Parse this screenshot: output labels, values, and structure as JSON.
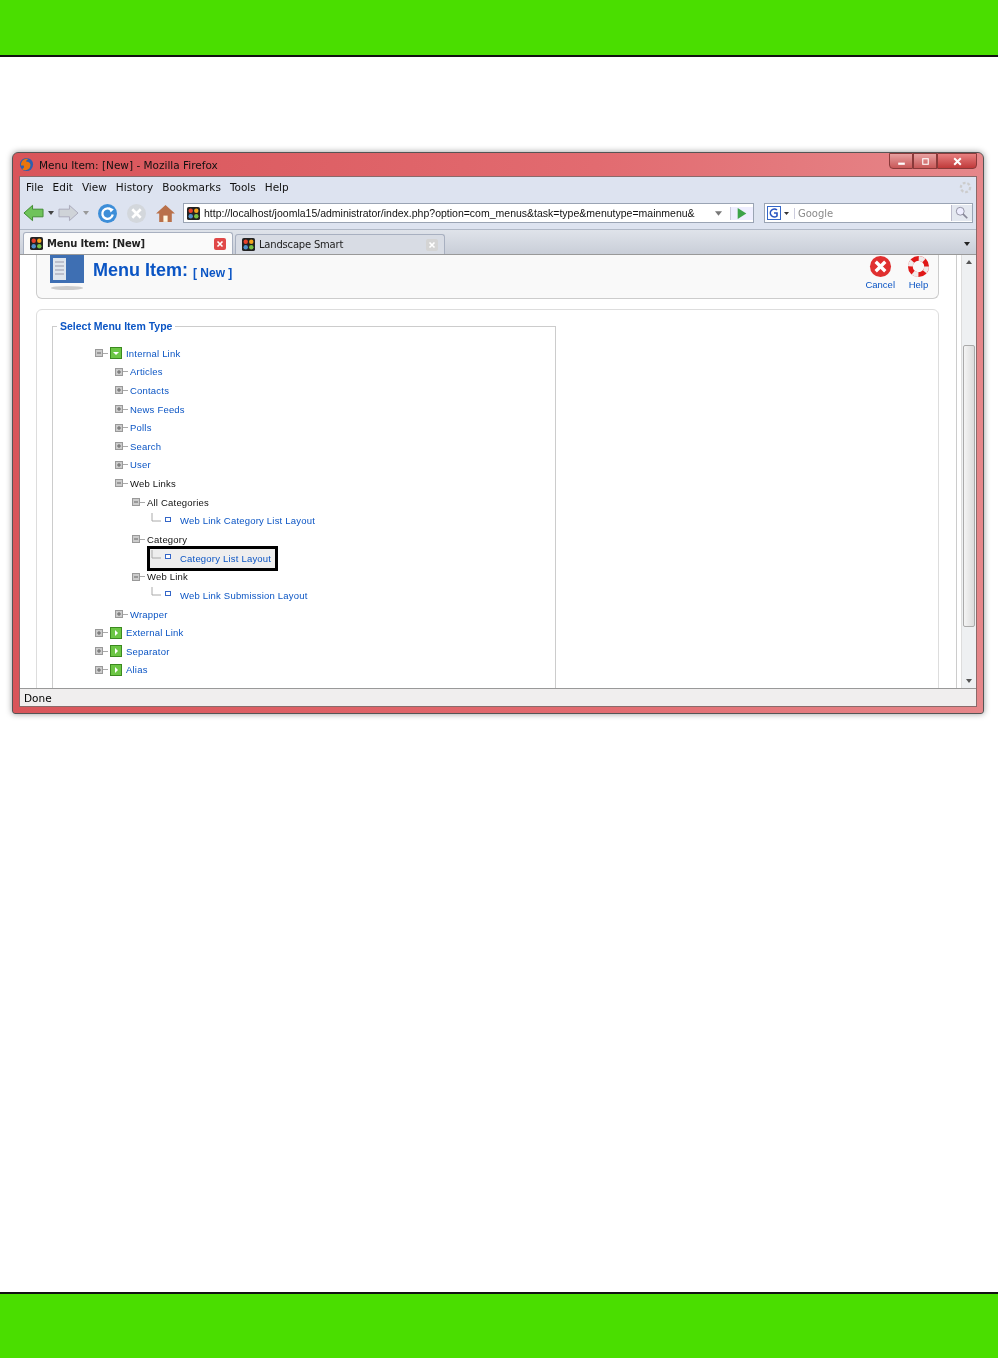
{
  "window": {
    "title": "Menu Item: [New] - Mozilla Firefox"
  },
  "menu": [
    "File",
    "Edit",
    "View",
    "History",
    "Bookmarks",
    "Tools",
    "Help"
  ],
  "address_bar": {
    "value": "http://localhost/joomla15/administrator/index.php?option=com_menus&task=type&menutype=mainmenu&"
  },
  "search": {
    "placeholder": "Google"
  },
  "tabs": [
    {
      "label": "Menu Item: [New]",
      "selected": true
    },
    {
      "label": "Landscape Smart",
      "selected": false
    }
  ],
  "page": {
    "title": "Menu Item:",
    "subtitle": "[ New ]",
    "toolbar": [
      {
        "label": "Cancel",
        "kind": "cancel"
      },
      {
        "label": "Help",
        "kind": "help"
      }
    ],
    "legend": "Select Menu Item Type",
    "tree": [
      {
        "label": "Internal Link",
        "kind": "type",
        "expanded": true,
        "link": true,
        "children": [
          {
            "label": "Articles",
            "kind": "group",
            "expanded": false,
            "link": true
          },
          {
            "label": "Contacts",
            "kind": "group",
            "expanded": false,
            "link": true
          },
          {
            "label": "News Feeds",
            "kind": "group",
            "expanded": false,
            "link": true
          },
          {
            "label": "Polls",
            "kind": "group",
            "expanded": false,
            "link": true
          },
          {
            "label": "Search",
            "kind": "group",
            "expanded": false,
            "link": true
          },
          {
            "label": "User",
            "kind": "group",
            "expanded": false,
            "link": true
          },
          {
            "label": "Web Links",
            "kind": "group",
            "expanded": true,
            "link": false,
            "children": [
              {
                "label": "All Categories",
                "kind": "group",
                "expanded": true,
                "link": false,
                "children": [
                  {
                    "label": "Web Link Category List Layout",
                    "kind": "layout",
                    "link": true,
                    "highlighted": false
                  }
                ]
              },
              {
                "label": "Category",
                "kind": "group",
                "expanded": true,
                "link": false,
                "children": [
                  {
                    "label": "Category List Layout",
                    "kind": "layout",
                    "link": true,
                    "highlighted": true
                  }
                ]
              },
              {
                "label": "Web Link",
                "kind": "group",
                "expanded": true,
                "link": false,
                "children": [
                  {
                    "label": "Web Link Submission Layout",
                    "kind": "layout",
                    "link": true,
                    "highlighted": false
                  }
                ]
              }
            ]
          },
          {
            "label": "Wrapper",
            "kind": "group",
            "expanded": false,
            "link": true
          }
        ]
      },
      {
        "label": "External Link",
        "kind": "type",
        "expanded": false,
        "link": true
      },
      {
        "label": "Separator",
        "kind": "type",
        "expanded": false,
        "link": true
      },
      {
        "label": "Alias",
        "kind": "type",
        "expanded": false,
        "link": true
      }
    ]
  },
  "status_bar": "Done"
}
